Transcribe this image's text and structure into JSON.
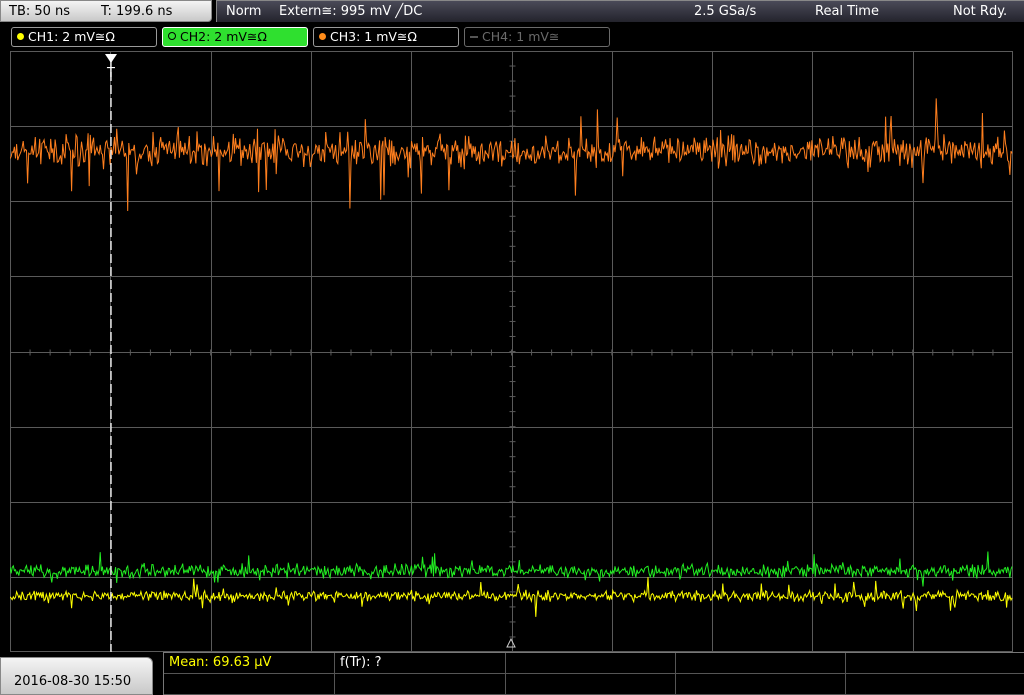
{
  "timebase": {
    "tb": "TB: 50 ns",
    "trigger_time": "T: 199.6 ns"
  },
  "status": {
    "mode": "Norm",
    "trigger": "Extern≅: 995 mV ╱DC",
    "sample_rate": "2.5 GSa/s",
    "acq_mode": "Real Time",
    "state": "Not Rdy."
  },
  "channels": [
    {
      "label": "CH1: 2 mV≅Ω",
      "color": "#ffff00",
      "active": false,
      "enabled": true
    },
    {
      "label": "CH2: 2 mV≅Ω",
      "color": "#2fe02f",
      "active": true,
      "enabled": true
    },
    {
      "label": "CH3: 1 mV≅Ω",
      "color": "#ff8c1a",
      "active": false,
      "enabled": true
    },
    {
      "label": "CH4: 1 mV≅",
      "color": "#6a6a6a",
      "active": false,
      "enabled": false
    }
  ],
  "trigger_marker": "T",
  "waveform_colors": {
    "ch1": "#ffff00",
    "ch2": "#22ee22",
    "ch3": "#ff7f1e",
    "grid": "#5a5a5a"
  },
  "datetime": "2016-08-30 15:50",
  "measurements": {
    "mean": "Mean: 69.63 µV",
    "freq": "f(Tr): ?"
  }
}
